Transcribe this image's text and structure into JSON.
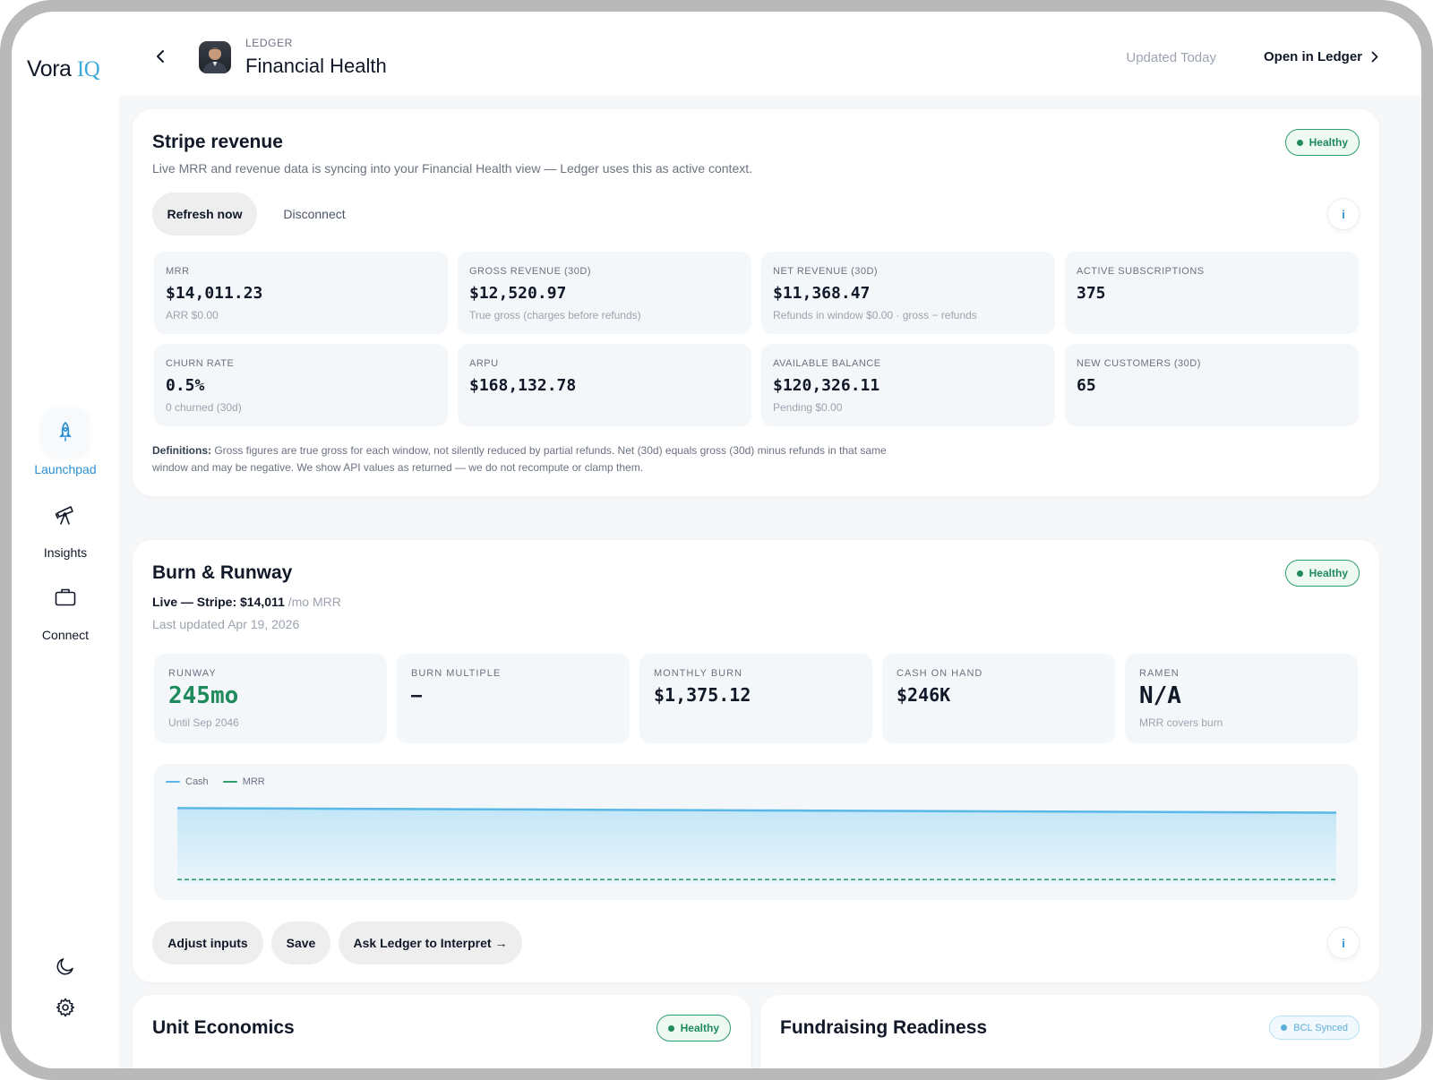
{
  "app": {
    "logo_main": "Vora",
    "logo_accent": "IQ"
  },
  "sidebar": {
    "items": [
      {
        "label": "Launchpad",
        "icon": "rocket-icon",
        "active": true
      },
      {
        "label": "Insights",
        "icon": "telescope-icon",
        "active": false
      },
      {
        "label": "Connect",
        "icon": "briefcase-icon",
        "active": false
      }
    ],
    "bottom_icons": [
      "moon-icon",
      "gear-icon"
    ]
  },
  "header": {
    "eyebrow": "LEDGER",
    "title": "Financial Health",
    "updated": "Updated Today",
    "open_link": "Open in Ledger"
  },
  "stripe": {
    "title": "Stripe revenue",
    "status": "Healthy",
    "description": "Live MRR and revenue data is syncing into your Financial Health view — Ledger uses this as active context.",
    "refresh_label": "Refresh now",
    "disconnect_label": "Disconnect",
    "info_label": "i",
    "metrics": [
      {
        "label": "MRR",
        "value": "$14,011.23",
        "sub": "ARR $0.00"
      },
      {
        "label": "GROSS REVENUE (30D)",
        "value": "$12,520.97",
        "sub": "True gross (charges before refunds)"
      },
      {
        "label": "NET REVENUE (30D)",
        "value": "$11,368.47",
        "sub": "Refunds in window $0.00 · gross − refunds"
      },
      {
        "label": "ACTIVE SUBSCRIPTIONS",
        "value": "375",
        "sub": ""
      },
      {
        "label": "CHURN RATE",
        "value": "0.5%",
        "sub": "0 churned (30d)"
      },
      {
        "label": "ARPU",
        "value": "$168,132.78",
        "sub": ""
      },
      {
        "label": "AVAILABLE BALANCE",
        "value": "$120,326.11",
        "sub": "Pending $0.00"
      },
      {
        "label": "NEW CUSTOMERS (30D)",
        "value": "65",
        "sub": ""
      }
    ],
    "definitions_label": "Definitions:",
    "definitions_text": " Gross figures are true gross for each window, not silently reduced by partial refunds. Net (30d) equals gross (30d) minus refunds in that same window and may be negative. We show API values as returned — we do not recompute or clamp them."
  },
  "burn": {
    "title": "Burn & Runway",
    "status": "Healthy",
    "live_prefix": "Live — Stripe: $14,011",
    "live_suffix": " /mo MRR",
    "last_updated": "Last updated Apr 19, 2026",
    "metrics": [
      {
        "label": "RUNWAY",
        "value": "245mo",
        "sub": "Until Sep 2046"
      },
      {
        "label": "BURN MULTIPLE",
        "value": "—",
        "sub": ""
      },
      {
        "label": "MONTHLY BURN",
        "value": "$1,375.12",
        "sub": ""
      },
      {
        "label": "CASH ON HAND",
        "value": "$246K",
        "sub": ""
      },
      {
        "label": "RAMEN",
        "value": "N/A",
        "sub": "MRR covers burn"
      }
    ],
    "adjust_label": "Adjust inputs",
    "save_label": "Save",
    "ask_label": "Ask Ledger to Interpret →",
    "info_label": "i"
  },
  "chart_data": {
    "type": "area",
    "series": [
      {
        "name": "Cash",
        "color": "#5ab8e6",
        "values": [
          246,
          244.5,
          243,
          241.5,
          240,
          238.5,
          237,
          235.5,
          234,
          232.5,
          231
        ]
      },
      {
        "name": "MRR",
        "color": "#2e9e6d",
        "values": [
          14,
          14,
          14,
          14,
          14,
          14,
          14,
          14,
          14,
          14,
          14
        ]
      }
    ],
    "ylim": [
      0,
      250
    ],
    "grid": false,
    "legend": "top-left"
  },
  "unit_economics": {
    "title": "Unit Economics",
    "status": "Healthy"
  },
  "fundraising": {
    "title": "Fundraising Readiness",
    "status": "BCL Synced"
  }
}
